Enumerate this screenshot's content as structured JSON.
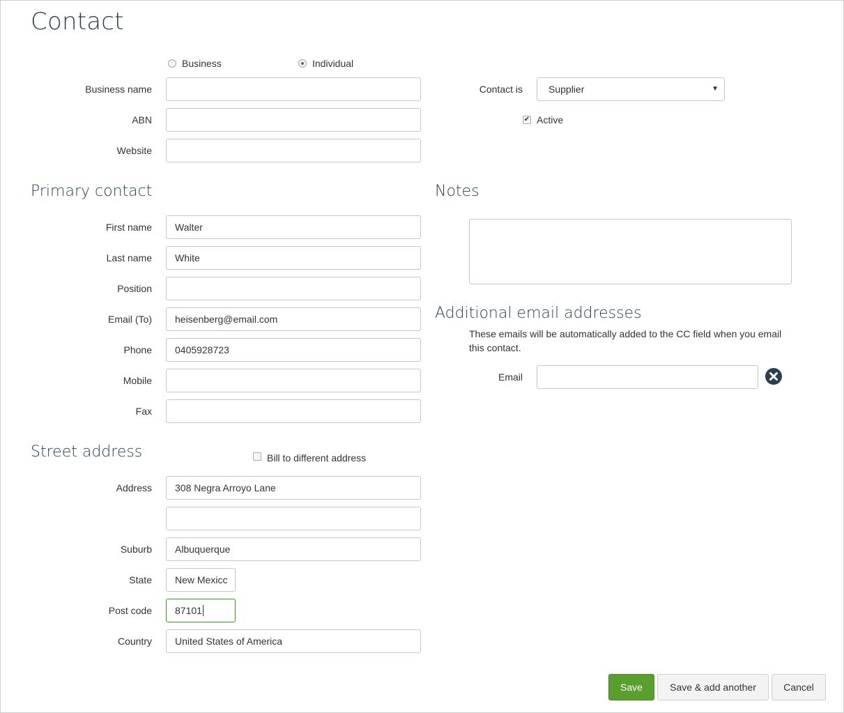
{
  "page": {
    "title": "Contact"
  },
  "entity_type": {
    "options": [
      {
        "label": "Business",
        "selected": false
      },
      {
        "label": "Individual",
        "selected": true
      }
    ]
  },
  "business": {
    "business_name": {
      "label": "Business name",
      "value": ""
    },
    "abn": {
      "label": "ABN",
      "value": ""
    },
    "website": {
      "label": "Website",
      "value": ""
    }
  },
  "contact_type": {
    "label": "Contact is",
    "selected": "Supplier",
    "active_label": "Active",
    "active_checked": true
  },
  "primary_contact": {
    "heading": "Primary contact",
    "first_name": {
      "label": "First name",
      "value": "Walter"
    },
    "last_name": {
      "label": "Last name",
      "value": "White"
    },
    "position": {
      "label": "Position",
      "value": ""
    },
    "email": {
      "label": "Email (To)",
      "value": "heisenberg@email.com"
    },
    "phone": {
      "label": "Phone",
      "value": "0405928723"
    },
    "mobile": {
      "label": "Mobile",
      "value": ""
    },
    "fax": {
      "label": "Fax",
      "value": ""
    }
  },
  "notes": {
    "heading": "Notes",
    "value": ""
  },
  "additional_emails": {
    "heading": "Additional email addresses",
    "helper": "These emails will be automatically added to the CC field when you email this contact.",
    "email_label": "Email",
    "email_value": "",
    "remove_icon": "close-circle-icon"
  },
  "street_address": {
    "heading": "Street address",
    "bill_different_label": "Bill to different address",
    "bill_different_checked": false,
    "address": {
      "label": "Address",
      "line1": "308 Negra Arroyo Lane",
      "line2": ""
    },
    "suburb": {
      "label": "Suburb",
      "value": "Albuquerque"
    },
    "state": {
      "label": "State",
      "value": "New Mexicc"
    },
    "postcode": {
      "label": "Post code",
      "value": "87101"
    },
    "country": {
      "label": "Country",
      "value": "United States of America"
    }
  },
  "actions": {
    "save": "Save",
    "save_add": "Save & add another",
    "cancel": "Cancel"
  },
  "colors": {
    "heading": "#2c3e50",
    "primary_button": "#5a9e2f",
    "focus_border": "#3c9d23"
  }
}
